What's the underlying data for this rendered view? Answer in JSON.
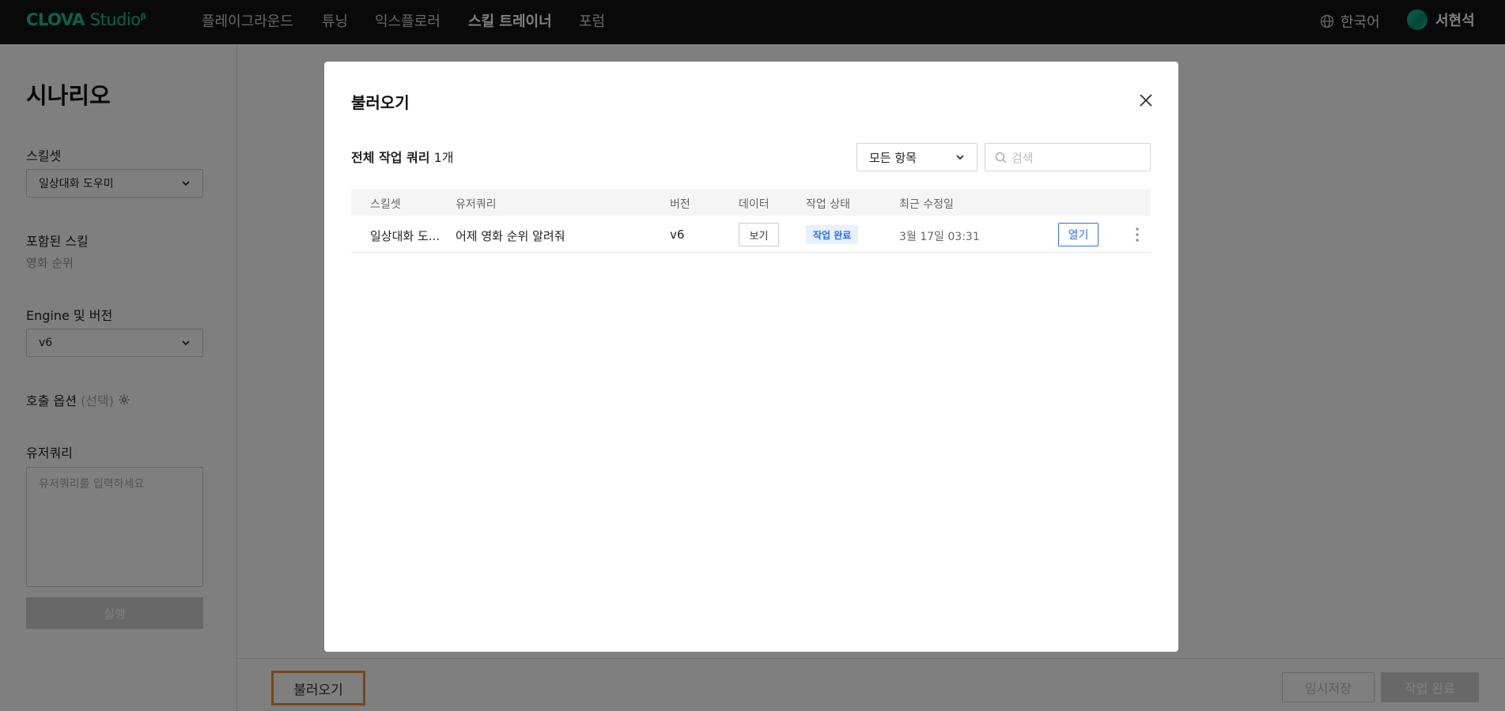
{
  "topnav": {
    "logo_main": "CLOVA",
    "logo_studio": "Studio",
    "logo_mark": "β",
    "items": [
      {
        "label": "플레이그라운드",
        "active": false
      },
      {
        "label": "튜닝",
        "active": false
      },
      {
        "label": "익스플로러",
        "active": false
      },
      {
        "label": "스킬 트레이너",
        "active": true
      },
      {
        "label": "포럼",
        "active": false
      }
    ],
    "language": "한국어",
    "user_name": "서현석"
  },
  "left": {
    "title": "시나리오",
    "skillset_label": "스킬셋",
    "skillset_value": "일상대화 도우미",
    "included_skill_label": "포함된 스킬",
    "included_skill_value": "영화 순위",
    "engine_label": "Engine 및 버전",
    "engine_value": "v6",
    "call_option_label": "호출 옵션",
    "call_option_hint": "(선택)",
    "user_query_label": "유저쿼리",
    "user_query_placeholder": "유저쿼리를 입력하세요",
    "run_label": "실행"
  },
  "bottom": {
    "load_label": "불러오기",
    "save_label": "임시저장",
    "done_label": "작업 완료"
  },
  "modal": {
    "title": "불러오기",
    "count_label": "전체 작업 쿼리",
    "count_value": "1개",
    "filter_value": "모든 항목",
    "search_placeholder": "검색",
    "columns": [
      "스킬셋",
      "유저쿼리",
      "버전",
      "데이터",
      "작업 상태",
      "최근 수정일"
    ],
    "rows": [
      {
        "skillset": "일상대화 도...",
        "query": "어제 영화 순위 알려줘",
        "version": "v6",
        "data_button": "보기",
        "status": "작업 완료",
        "modified": "3월 17일 03:31",
        "open_button": "열기"
      }
    ]
  },
  "colors": {
    "brand": "#18c39b",
    "accent_blue": "#2d72e8",
    "highlight_orange": "#f58a2a"
  }
}
